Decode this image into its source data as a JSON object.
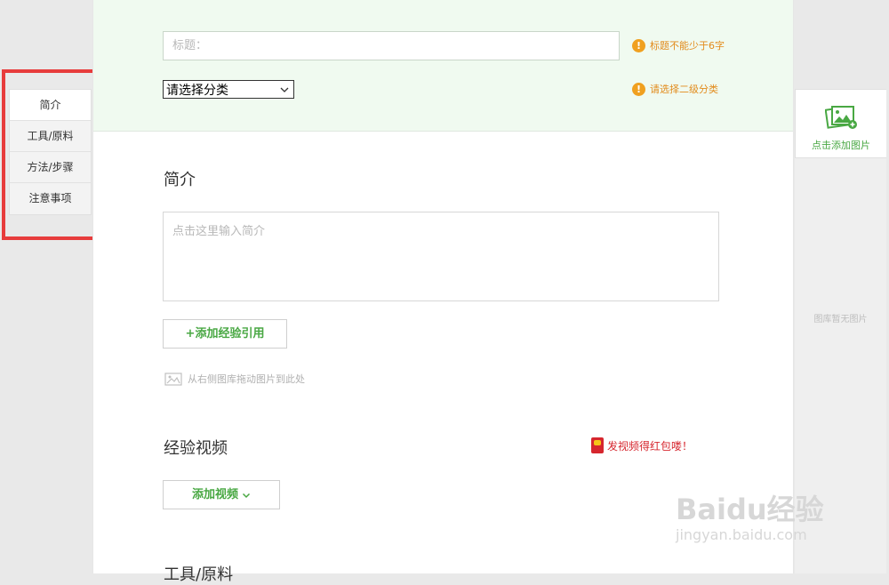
{
  "left_nav": {
    "items": [
      {
        "label": "简介",
        "active": true
      },
      {
        "label": "工具/原料",
        "active": false
      },
      {
        "label": "方法/步骤",
        "active": false
      },
      {
        "label": "注意事项",
        "active": false
      }
    ]
  },
  "header": {
    "title_placeholder": "标题：",
    "title_hint": "标题不能少于6字",
    "category_selected": "请选择分类",
    "category_hint": "请选择二级分类"
  },
  "intro": {
    "heading": "简介",
    "placeholder": "点击这里输入简介",
    "add_reference_label": "+添加经验引用",
    "drag_hint": "从右侧图库拖动图片到此处"
  },
  "video": {
    "heading": "经验视频",
    "promo": "发视频得红包喽！",
    "add_video_label": "添加视频"
  },
  "tools": {
    "heading": "工具/原料"
  },
  "right_panel": {
    "add_image_label": "点击添加图片",
    "empty_text": "图库暂无图片"
  },
  "watermark": {
    "brand": "Baidu经验",
    "url": "jingyan.baidu.com"
  },
  "colors": {
    "accent_green": "#49a843",
    "warning_orange": "#e28b1c",
    "highlight_red": "#e73c3c",
    "header_bg": "#f0faf0"
  }
}
